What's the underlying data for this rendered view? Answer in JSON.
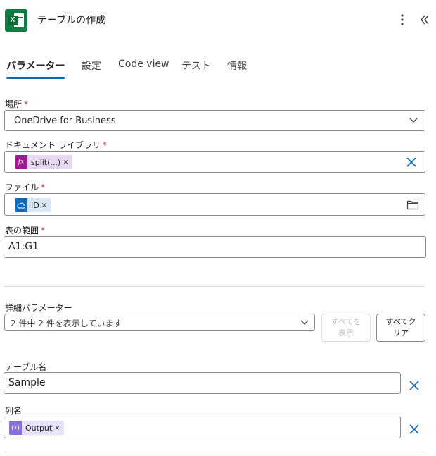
{
  "header": {
    "title": "テーブルの作成",
    "app_icon": "excel-icon"
  },
  "tabs": [
    {
      "label": "パラメーター",
      "active": true
    },
    {
      "label": "設定"
    },
    {
      "label": "Code view"
    },
    {
      "label": "テスト"
    },
    {
      "label": "情報"
    }
  ],
  "fields": {
    "location": {
      "label": "場所",
      "required": "*",
      "value": "OneDrive for Business"
    },
    "library": {
      "label": "ドキュメント ライブラリ",
      "required": "*",
      "token": {
        "label": "split(...)",
        "icon": "fx",
        "close": "×"
      }
    },
    "file": {
      "label": "ファイル",
      "required": "*",
      "token": {
        "label": "ID",
        "close": "×"
      }
    },
    "range": {
      "label": "表の範囲",
      "required": "*",
      "value": "A1:G1"
    }
  },
  "advanced": {
    "label": "詳細パラメーター",
    "select_value": "2 件中 2 件を表示しています",
    "show_all": "すべてを\n表示",
    "clear_all": "すべてク\nリア"
  },
  "table_name": {
    "label": "テーブル名",
    "value": "Sample"
  },
  "columns": {
    "label": "列名",
    "token": {
      "label": "Output",
      "icon": "{x}",
      "close": "×"
    }
  },
  "colors": {
    "accent": "#0f6cbd",
    "excel": "#107c41",
    "fx_token": "#9c1b8e",
    "onedrive_token": "#0f6cbd",
    "variable_token": "#8a6fe0"
  }
}
